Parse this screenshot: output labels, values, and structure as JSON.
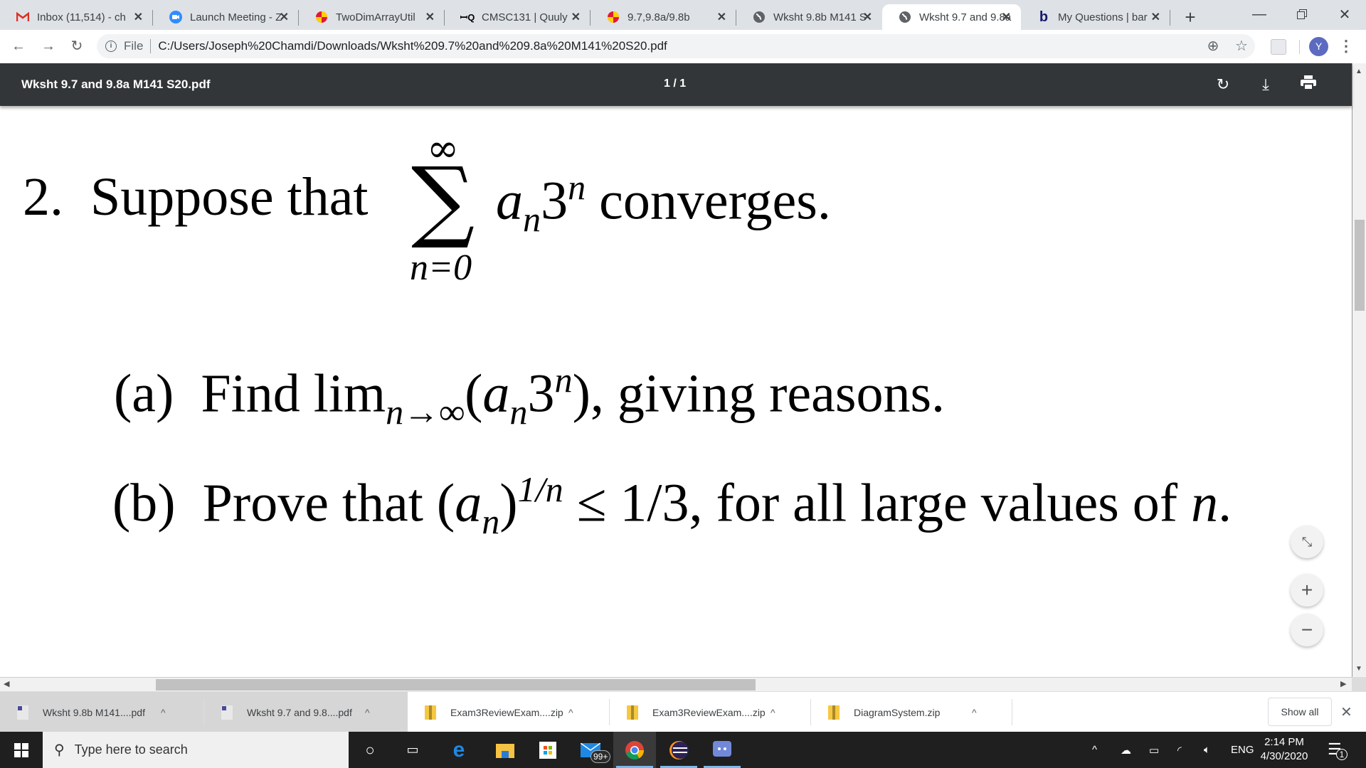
{
  "browser": {
    "tabs": [
      {
        "label": "Inbox (11,514) - ch",
        "icon": "gmail-icon",
        "active": false
      },
      {
        "label": "Launch Meeting - Z",
        "icon": "zoom-icon",
        "active": false
      },
      {
        "label": "TwoDimArrayUtil",
        "icon": "umd-icon",
        "active": false
      },
      {
        "label": "CMSC131 | Quuly",
        "icon": "quuly-icon",
        "active": false
      },
      {
        "label": "9.7,9.8a/9.8b",
        "icon": "umd-icon",
        "active": false
      },
      {
        "label": "Wksht 9.8b M141 S",
        "icon": "globe-icon",
        "active": false
      },
      {
        "label": "Wksht 9.7 and 9.8a",
        "icon": "globe-icon",
        "active": true
      },
      {
        "label": "My Questions | bar",
        "icon": "bartleby-icon",
        "active": false
      }
    ],
    "new_tab": "+",
    "close_glyph": "✕",
    "address": {
      "scheme_label": "File",
      "url": "C:/Users/Joseph%20Chamdi/Downloads/Wksht%209.7%20and%209.8a%20M141%20S20.pdf"
    },
    "profile_initial": "Y"
  },
  "pdf_viewer": {
    "title": "Wksht 9.7 and 9.8a M141 S20.pdf",
    "page_indicator": "1 / 1",
    "zoom_controls": {
      "fit": "fit-icon",
      "plus": "+",
      "minus": "−"
    }
  },
  "document": {
    "q2": {
      "number": "2.",
      "lead": "Suppose that",
      "sum_upper": "∞",
      "sum_symbol": "∑",
      "sum_lower": "n=0",
      "term_base": "a",
      "term_sub": "n",
      "term_factor": "3",
      "term_exp": "n",
      "tail": "converges."
    },
    "part_a": {
      "label": "(a)",
      "text1": "Find lim",
      "lim_sub": "n→∞",
      "expr_open": "(",
      "expr_base": "a",
      "expr_sub": "n",
      "expr_factor": "3",
      "expr_exp": "n",
      "expr_close": "),",
      "text2": "giving reasons."
    },
    "part_b": {
      "label": "(b)",
      "text1": "Prove that",
      "open": "(",
      "base": "a",
      "sub": "n",
      "close": ")",
      "exp": "1/n",
      "rel": "≤ 1/3,",
      "text2": "for all large values of",
      "var": "n",
      "end": "."
    }
  },
  "downloads": {
    "items": [
      {
        "name": "Wksht 9.8b M141....pdf",
        "type": "pdf"
      },
      {
        "name": "Wksht 9.7 and 9.8....pdf",
        "type": "pdf"
      },
      {
        "name": "Exam3ReviewExam....zip",
        "type": "zip"
      },
      {
        "name": "Exam3ReviewExam....zip",
        "type": "zip"
      },
      {
        "name": "DiagramSystem.zip",
        "type": "zip"
      }
    ],
    "show_all": "Show all"
  },
  "taskbar": {
    "search_placeholder": "Type here to search",
    "mail_badge": "99+",
    "language": "ENG",
    "time": "2:14 PM",
    "date": "4/30/2020",
    "notification_count": "1"
  }
}
